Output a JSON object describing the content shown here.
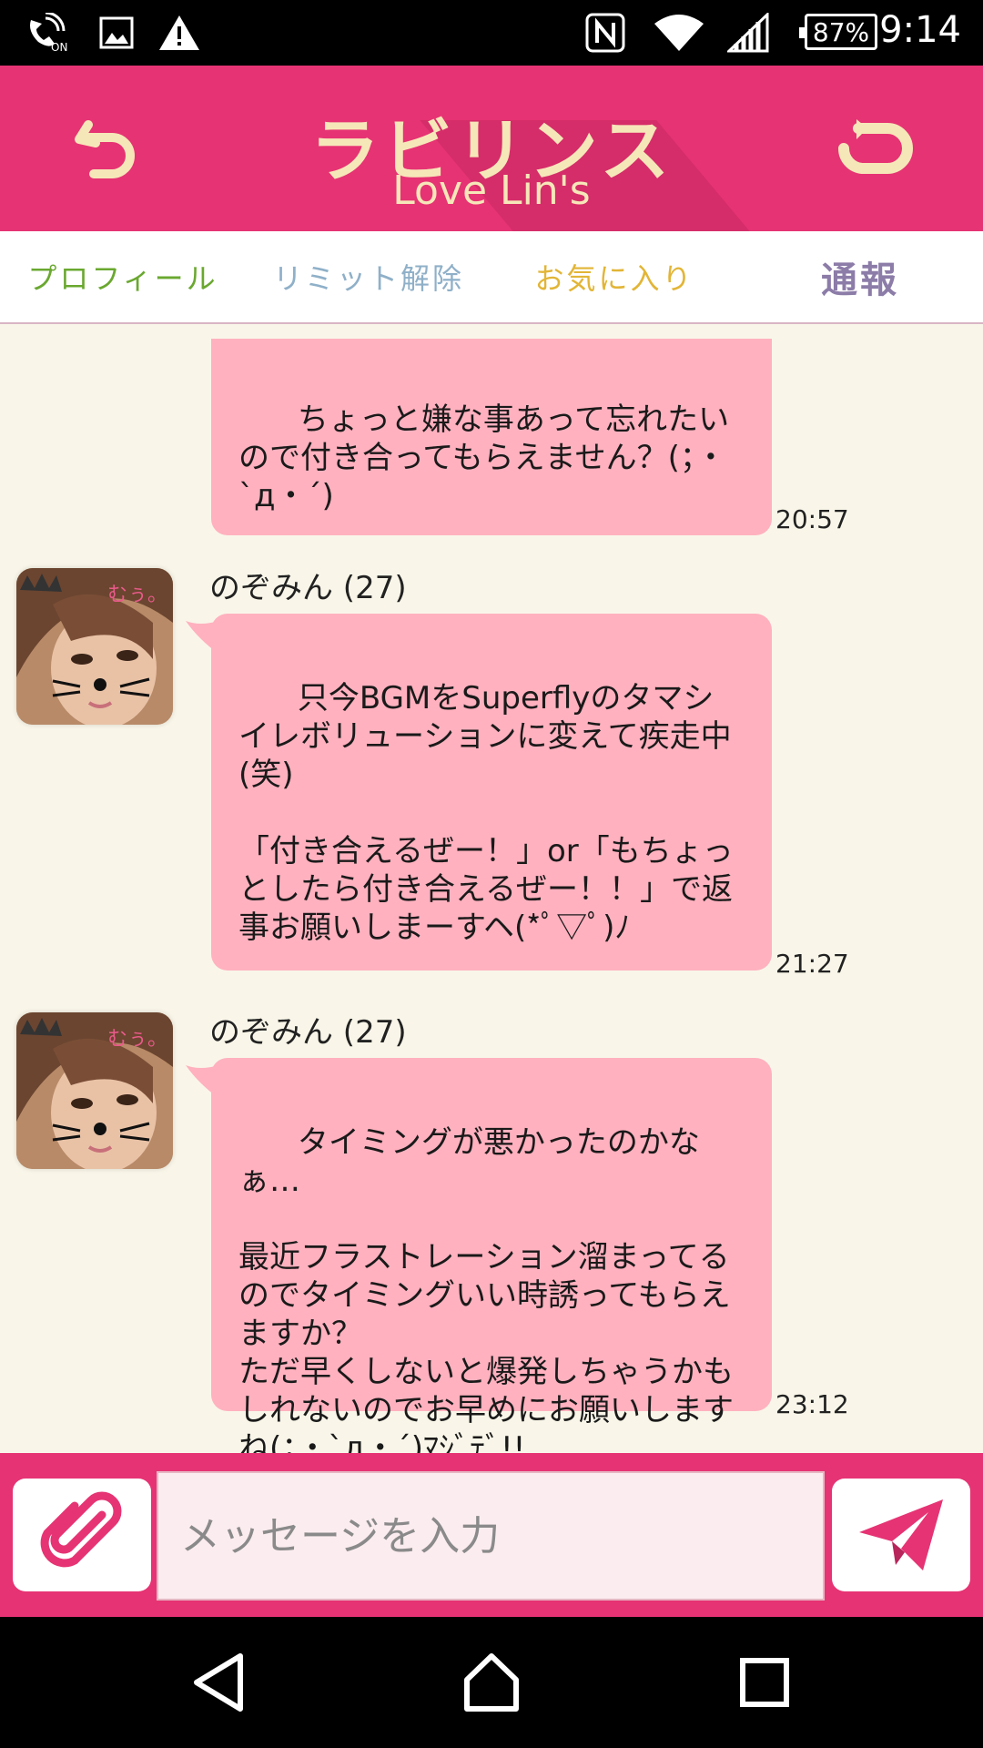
{
  "status_bar": {
    "time": "9:14",
    "battery": "87%",
    "icons": [
      "wifi-calling-on-icon",
      "image-icon",
      "warning-icon",
      "nfc-icon",
      "wifi-icon",
      "signal-icon",
      "battery-icon"
    ]
  },
  "header": {
    "logo_title": "ラビリンス",
    "logo_subtitle": "Love Lin's",
    "back_icon": "undo-arrow-icon",
    "refresh_icon": "refresh-icon"
  },
  "tabs": [
    {
      "label": "プロフィール",
      "color": "#6aa830"
    },
    {
      "label": "リミット解除",
      "color": "#8fb0c8"
    },
    {
      "label": "お気に入り",
      "color": "#e2b536"
    },
    {
      "label": "通報",
      "color": "#8c7ca8"
    }
  ],
  "messages": [
    {
      "text": "ちょっと嫌な事あって忘れたいので付き合ってもらえません？(；・`д・´)",
      "time": "20:57"
    },
    {
      "sender": "のぞみん (27)",
      "text": "只今BGMをSuperflyのタマシイレボリューションに変えて疾走中(笑)\n\n「付き合えるぜー！」or「もちょっとしたら付き合えるぜー！！」で返事お願いしまーすヘ(*ﾟ▽ﾟ)ﾉ",
      "time": "21:27"
    },
    {
      "sender": "のぞみん (27)",
      "text": "タイミングが悪かったのかなぁ…\n\n最近フラストレーション溜まってるのでタイミングいい時誘ってもらえますか？\nただ早くしないと爆発しちゃうかもしれないのでお早めにお願いしますね(；・`д・´)ﾏｼﾞﾃﾞ!!",
      "time": "23:12"
    }
  ],
  "input": {
    "placeholder": "メッセージを入力",
    "attach_icon": "paperclip-icon",
    "send_icon": "send-icon"
  },
  "nav": [
    "back-icon",
    "home-icon",
    "recents-icon"
  ],
  "colors": {
    "header": "#e63373",
    "bubble": "#ffb1bf",
    "chat_bg": "#f9f6e9",
    "logo_text": "#f6e7b9"
  }
}
